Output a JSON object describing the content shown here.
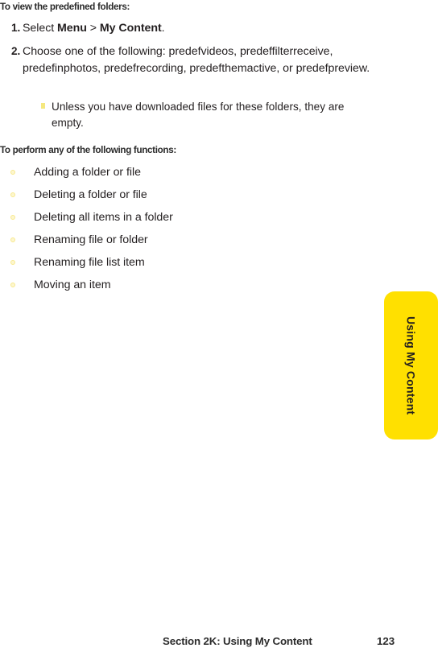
{
  "page": {
    "background_color": "#ffffff",
    "text_color": "#231f20",
    "accent_color": "#ffe000",
    "bullet_color": "#f7e98d"
  },
  "headings": {
    "view_folders": "To view the predefined folders:",
    "perform_functions": "To perform any of the following functions:"
  },
  "steps": [
    {
      "number": "1.",
      "text_before": "Select ",
      "bold_1": "Menu",
      "text_mid": " > ",
      "bold_2": "My Content",
      "text_after": "."
    },
    {
      "number": "2.",
      "text": "Choose one of the following: predefvideos, predeffilterreceive, predefinphotos, predefrecording, predefthemactive, or predefpreview."
    }
  ],
  "subnote": {
    "marker": "note-square-bullet",
    "text": "Unless you have downloaded files for these folders, they are empty."
  },
  "function_list": [
    {
      "bullet": "circle-bullet",
      "label": "Adding a folder or file"
    },
    {
      "bullet": "circle-bullet",
      "label": "Deleting a folder or file"
    },
    {
      "bullet": "circle-bullet",
      "label": "Deleting all items in a folder"
    },
    {
      "bullet": "circle-bullet",
      "label": "Renaming file or folder"
    },
    {
      "bullet": "circle-bullet",
      "label": "Renaming file list item"
    },
    {
      "bullet": "circle-bullet",
      "label": "Moving an item"
    }
  ],
  "side_tab": {
    "label": "Using My Content",
    "color": "#ffe000"
  },
  "footer": {
    "title": "Section 2K: Using My Content",
    "page_number": "123"
  }
}
